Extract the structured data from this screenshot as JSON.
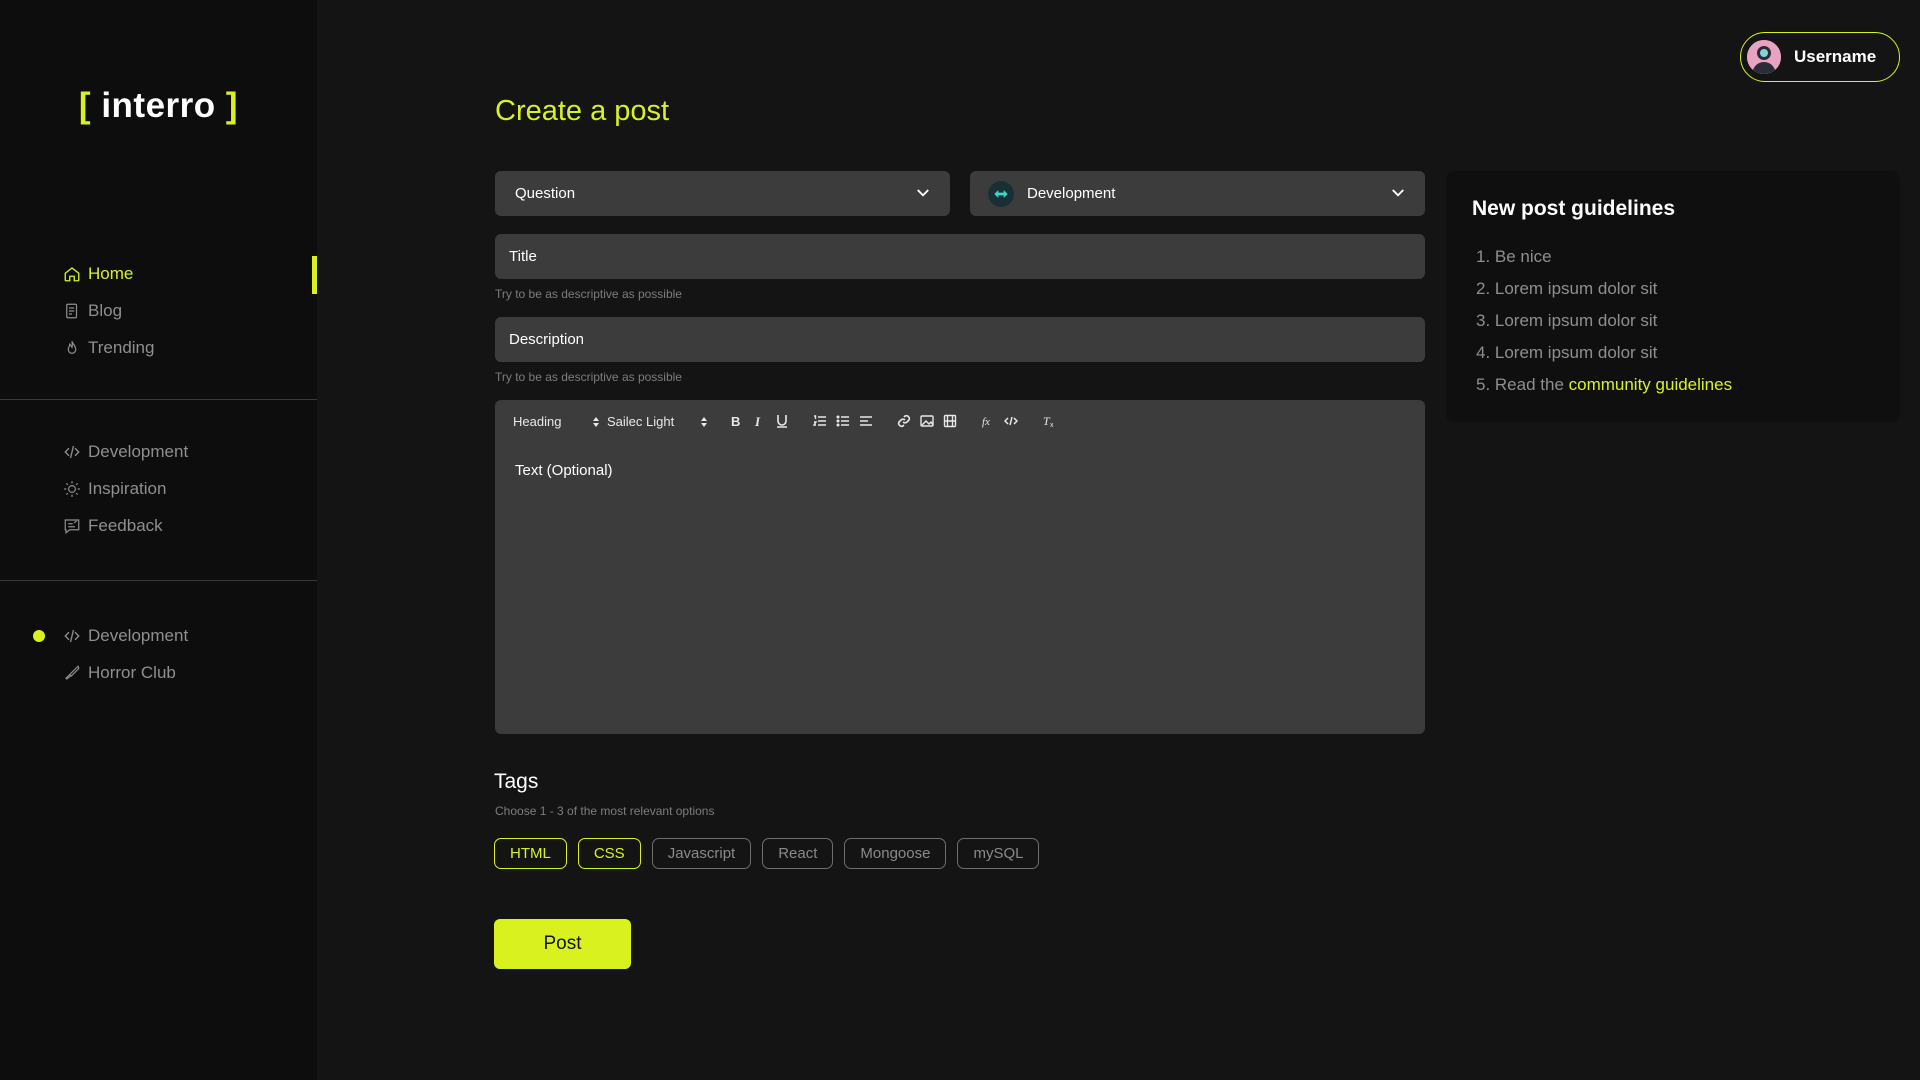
{
  "app": {
    "logo_text": "interro",
    "logo_bracket_open": "[",
    "logo_bracket_close": "]"
  },
  "colors": {
    "accent": "#d9f21f",
    "background": "#141414",
    "sidebar": "#0d0d0d",
    "field": "#3c3c3c",
    "muted": "#8f8f8f"
  },
  "sidebar": {
    "main_nav": [
      {
        "label": "Home",
        "icon": "home-icon",
        "active": true
      },
      {
        "label": "Blog",
        "icon": "blog-icon"
      },
      {
        "label": "Trending",
        "icon": "flame-icon"
      }
    ],
    "categories": [
      {
        "label": "Development",
        "icon": "code-icon"
      },
      {
        "label": "Inspiration",
        "icon": "sun-icon"
      },
      {
        "label": "Feedback",
        "icon": "feedback-icon"
      }
    ],
    "communities": [
      {
        "label": "Development",
        "icon": "code-icon",
        "unread": true
      },
      {
        "label": "Horror Club",
        "icon": "knife-icon"
      }
    ]
  },
  "user": {
    "name": "Username",
    "avatar_icon": "avatar-icon"
  },
  "form": {
    "page_title": "Create a post",
    "post_type": "Question",
    "community": "Development",
    "title_placeholder": "Title",
    "title_hint": "Try to be as descriptive as possible",
    "description_placeholder": "Description",
    "description_hint": "Try to be as descriptive as possible",
    "toolbar": {
      "heading": "Heading",
      "font": "Sailec Light",
      "buttons": [
        "bold-icon",
        "italic-icon",
        "underline-icon",
        "ordered-list-icon",
        "bullet-list-icon",
        "align-icon",
        "link-icon",
        "image-icon",
        "video-icon",
        "formula-icon",
        "code-icon",
        "clear-format-icon"
      ]
    },
    "editor_placeholder": "Text (Optional)",
    "tags_title": "Tags",
    "tags_hint": "Choose 1 - 3 of the most relevant options",
    "tags": [
      {
        "label": "HTML",
        "selected": true
      },
      {
        "label": "CSS",
        "selected": true
      },
      {
        "label": "Javascript",
        "selected": false
      },
      {
        "label": "React",
        "selected": false
      },
      {
        "label": "Mongoose",
        "selected": false
      },
      {
        "label": "mySQL",
        "selected": false
      }
    ],
    "post_label": "Post"
  },
  "guidelines": {
    "title": "New post guidelines",
    "items": [
      "1. Be nice",
      "2. Lorem ipsum dolor sit",
      "3. Lorem ipsum dolor sit",
      "4. Lorem ipsum dolor sit"
    ],
    "last_item_prefix": "5. Read the ",
    "last_item_link": "community guidelines"
  }
}
